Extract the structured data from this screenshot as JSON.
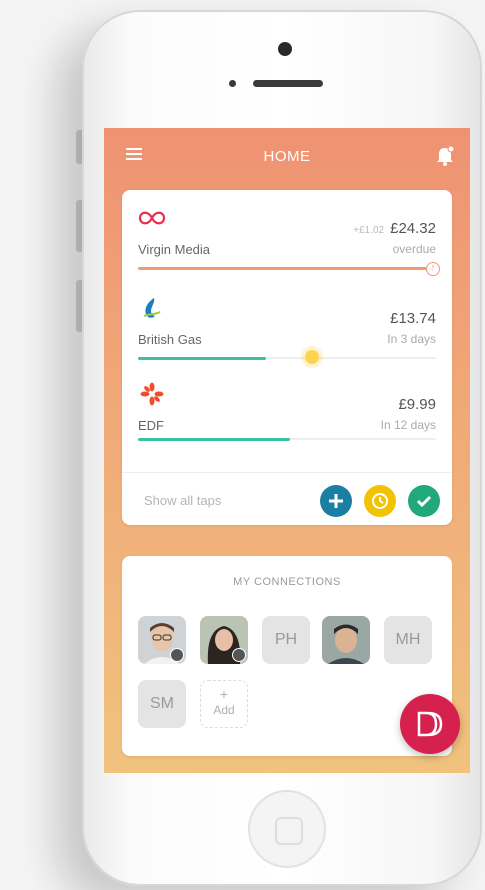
{
  "screen": {
    "title": "HOME",
    "bills": [
      {
        "name": "Virgin Media",
        "previous_amount": "+£1.02",
        "amount": "£24.32",
        "due": "overdue",
        "progress": 1.0,
        "color": "#f39a73",
        "logo": "virgin-media-logo-icon"
      },
      {
        "name": "British Gas",
        "amount": "£13.74",
        "due": "In 3 days",
        "progress": 0.43,
        "marker": 0.58,
        "color": "#3fbfa2",
        "logo": "british-gas-flame-icon"
      },
      {
        "name": "EDF",
        "amount": "£9.99",
        "due": "In 12 days",
        "progress": 0.51,
        "color": "#3fbfa2",
        "logo": "edf-flower-icon"
      }
    ],
    "footer": {
      "show_all": "Show all taps",
      "actions": [
        "add-icon",
        "clock-icon",
        "check-icon"
      ]
    },
    "connections": {
      "title": "MY CONNECTIONS",
      "people": [
        {
          "type": "photo"
        },
        {
          "type": "photo"
        },
        {
          "type": "initials",
          "label": "PH"
        },
        {
          "type": "photo"
        },
        {
          "type": "initials",
          "label": "MH"
        },
        {
          "type": "initials",
          "label": "SM"
        }
      ],
      "add_label": "Add",
      "add_symbol": "+"
    }
  },
  "colors": {
    "accent_top": "#ef9272",
    "accent_bottom": "#f0c27e",
    "fab": "#d6204e",
    "add": "#1b7fa3",
    "clock": "#f2c300",
    "check": "#21a87b"
  }
}
